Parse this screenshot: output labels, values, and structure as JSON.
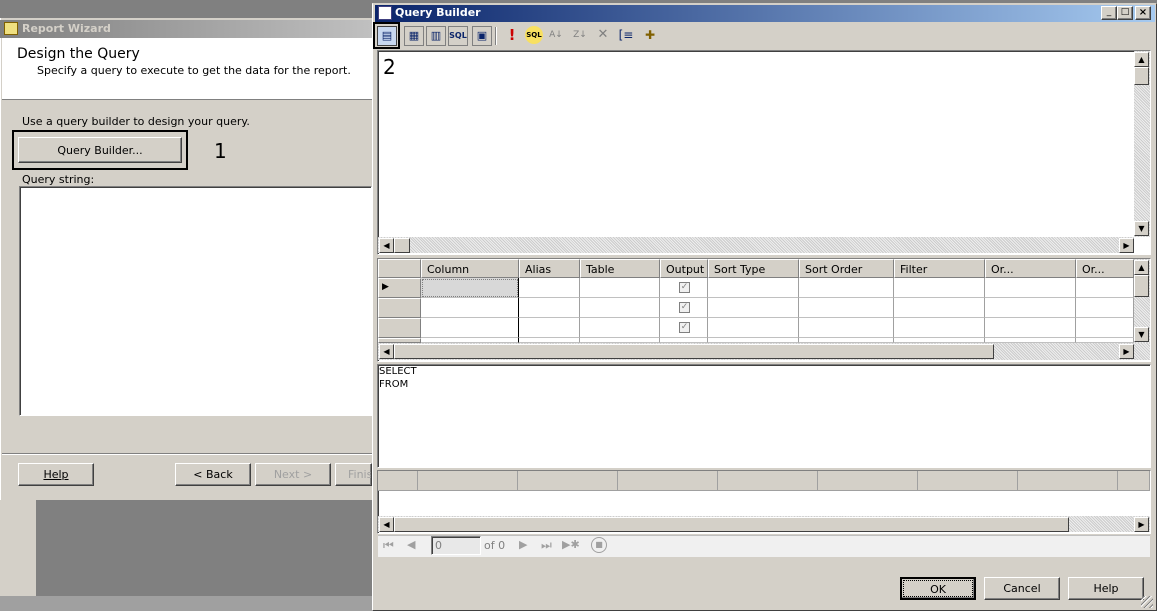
{
  "wizard": {
    "title": "Report Wizard",
    "heading": "Design the Query",
    "subheading": "Specify a query to execute to get the data for the report.",
    "instruction": "Use a query builder to design your query.",
    "query_builder_button": "Query Builder...",
    "callout_1": "1",
    "query_string_label": "Query string:",
    "help_button": "Help",
    "back_button": "< Back",
    "next_button": "Next >",
    "finish_button": "Finis"
  },
  "builder": {
    "title": "Query Builder",
    "callout_2": "2",
    "columns": [
      "Column",
      "Alias",
      "Table",
      "Output",
      "Sort Type",
      "Sort Order",
      "Filter",
      "Or...",
      "Or..."
    ],
    "sql_text": [
      "SELECT",
      "FROM"
    ],
    "nav_position": "0",
    "nav_of": "of 0",
    "ok_button": "OK",
    "cancel_button": "Cancel",
    "help_button": "Help",
    "toolbar_icons": [
      "toggle-diagram-pane-icon",
      "toggle-criteria-pane-icon",
      "toggle-sql-pane-icon",
      "toggle-results-pane-icon",
      "execute-sql-icon",
      "verify-sql-icon",
      "sort-ascending-icon",
      "sort-descending-icon",
      "remove-filter-icon",
      "use-group-by-icon",
      "add-table-icon"
    ]
  },
  "colors": {
    "titlebar_active": "#0a246a",
    "window_face": "#d4d0c8",
    "execute_icon": "#cc0000"
  }
}
